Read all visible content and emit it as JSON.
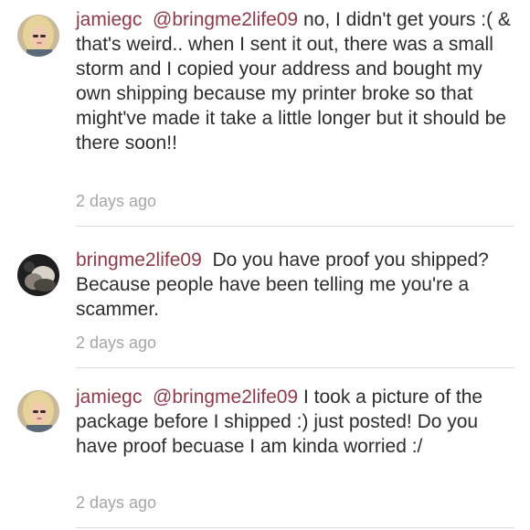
{
  "comments": [
    {
      "username": "jamiegc",
      "mention": "@bringme2life09",
      "text": " no, I didn't get yours :( & that's weird.. when I sent it out, there was a small storm and I copied your address and bought my own shipping because my printer broke so that might've made it take a little longer but it should be there soon!!",
      "timestamp": "2 days ago",
      "avatar": "blonde-user-avatar"
    },
    {
      "username": "bringme2life09",
      "mention": "",
      "text": "Do you have proof you shipped? Because people have been telling me you're a scammer.",
      "timestamp": "2 days ago",
      "avatar": "dark-user-avatar"
    },
    {
      "username": "jamiegc",
      "mention": "@bringme2life09",
      "text": " I took a picture of the package before I shipped :) just posted! Do you have proof becuase I am kinda worried :/",
      "timestamp": "2 days ago",
      "avatar": "blonde-user-avatar"
    }
  ],
  "colors": {
    "username": "#8f3a4a",
    "body_text": "#2d2d2d",
    "timestamp": "#a6a6a6",
    "divider": "#dcdcdc"
  }
}
